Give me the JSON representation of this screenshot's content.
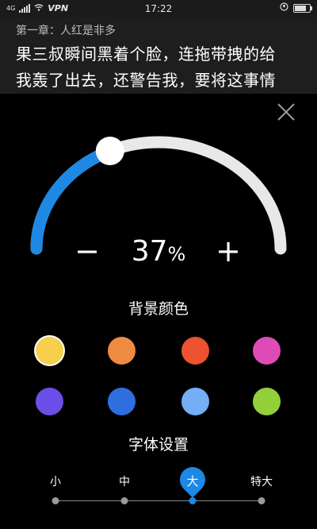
{
  "status_bar": {
    "network_type": "4G",
    "vpn_label": "VPN",
    "time": "17:22"
  },
  "reader": {
    "chapter_title": "第一章：人红是非多",
    "line1": "果三叔瞬间黑着个脸，连拖带拽的给",
    "line2": "我轰了出去，还警告我，要将这事情"
  },
  "brightness": {
    "value_number": "37",
    "value_unit": "%",
    "level_fraction": 0.37,
    "minus_label": "−",
    "plus_label": "+"
  },
  "background": {
    "title": "背景颜色",
    "colors": [
      {
        "name": "yellow",
        "hex": "#f6d04d",
        "selected": true
      },
      {
        "name": "orange",
        "hex": "#ef8a43"
      },
      {
        "name": "red",
        "hex": "#ec5130"
      },
      {
        "name": "magenta",
        "hex": "#de4bb7"
      },
      {
        "name": "purple",
        "hex": "#6a4ee6"
      },
      {
        "name": "blue",
        "hex": "#2f6ee0"
      },
      {
        "name": "light-blue",
        "hex": "#74aef4"
      },
      {
        "name": "green",
        "hex": "#93cf3a"
      }
    ]
  },
  "font": {
    "title": "字体设置",
    "sizes": [
      "小",
      "中",
      "大",
      "特大"
    ],
    "selected_index": 2
  },
  "colors": {
    "accent": "#1e88e5",
    "track": "#e8e8e8"
  }
}
